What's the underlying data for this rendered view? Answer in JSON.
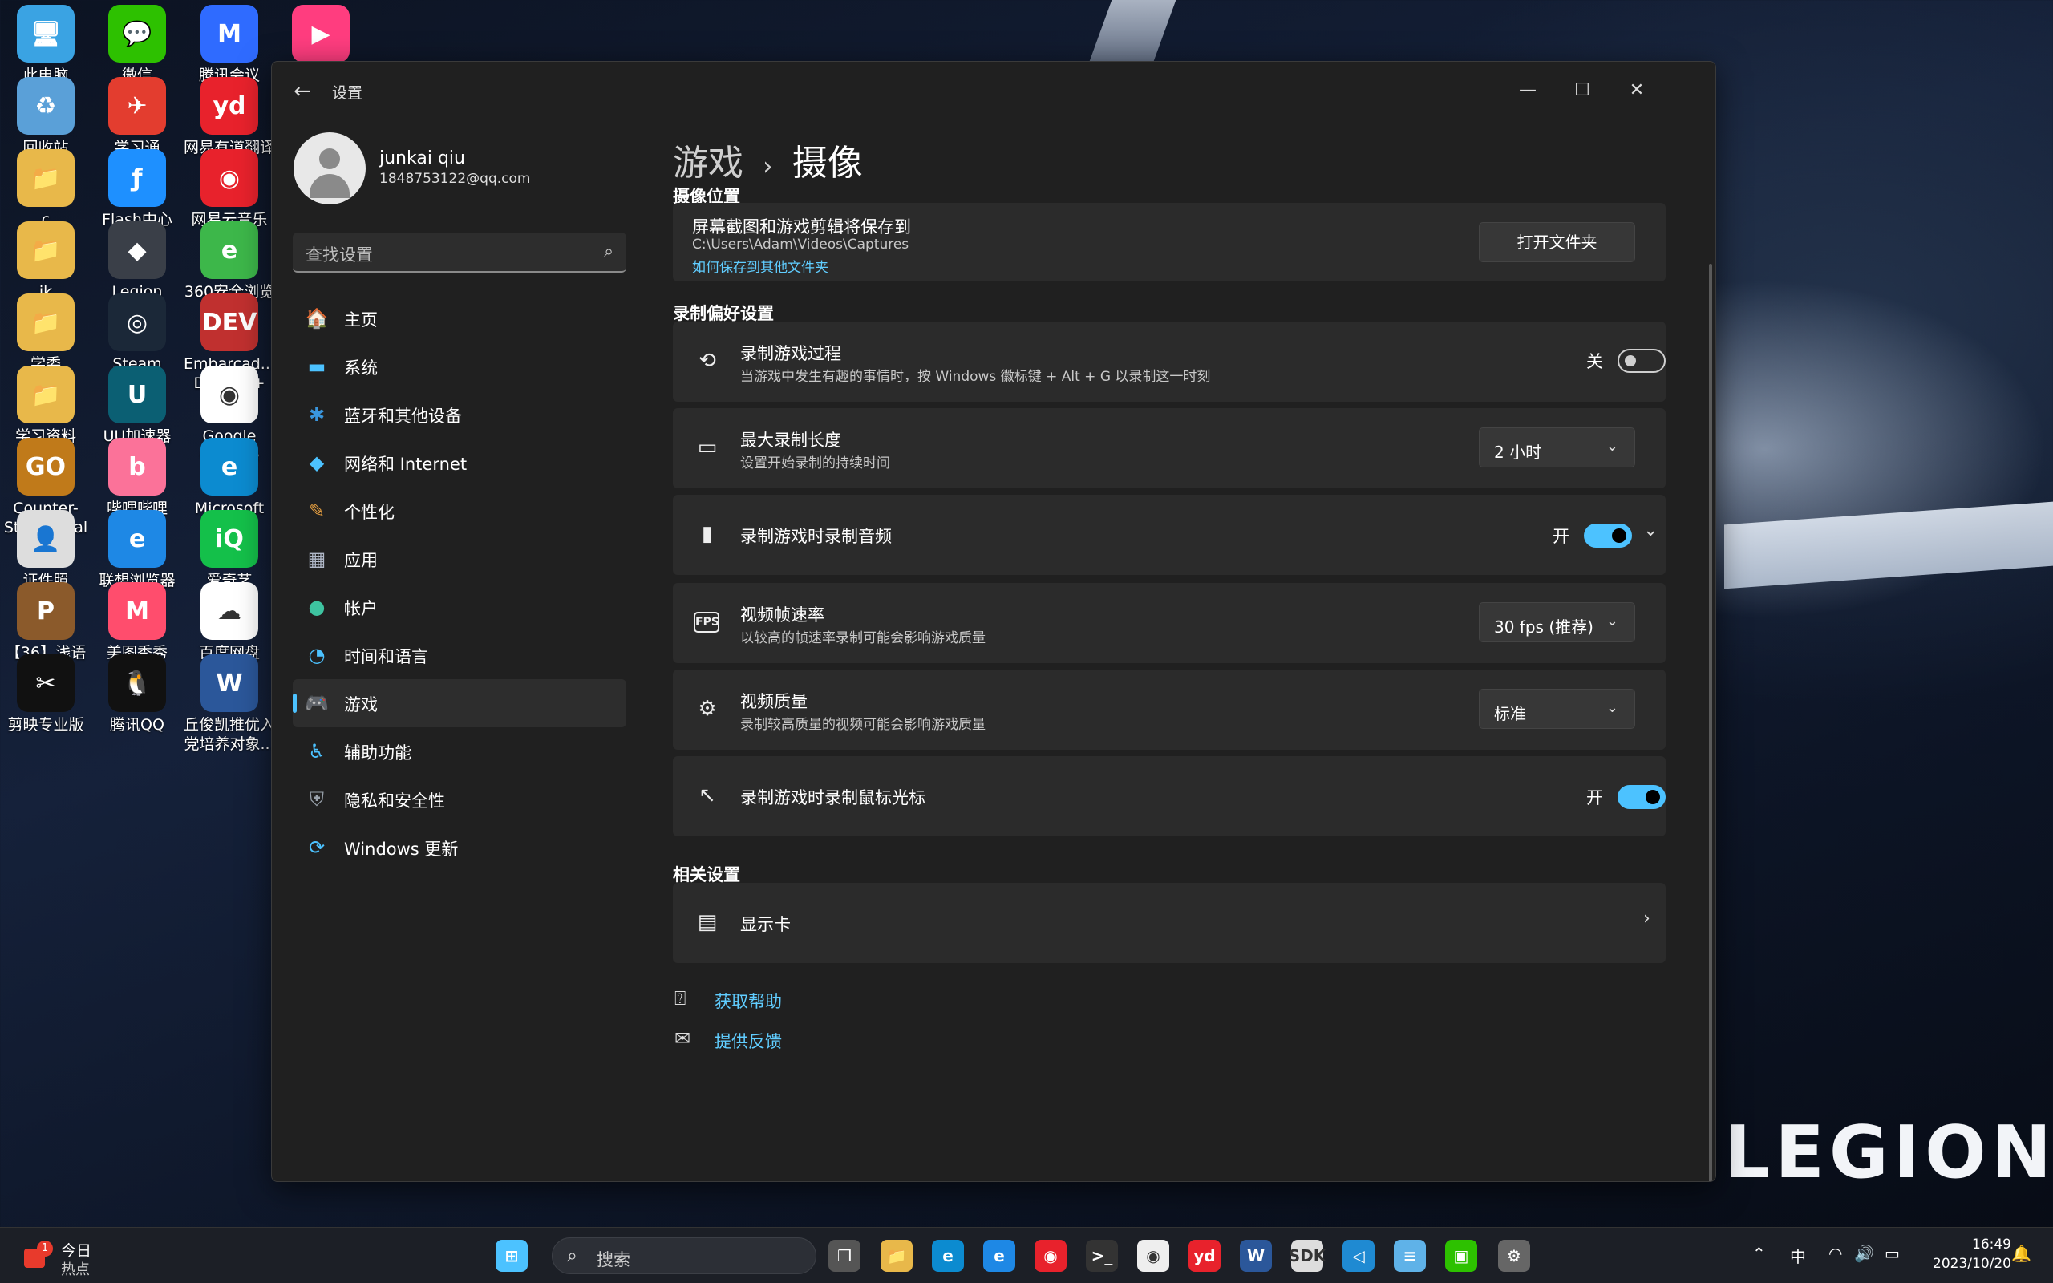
{
  "desktop": {
    "icons": [
      {
        "label": "此电脑",
        "color": "#3aa3e3",
        "glyph": "🖥"
      },
      {
        "label": "微信",
        "color": "#2dc100",
        "glyph": "💬"
      },
      {
        "label": "腾讯会议",
        "color": "#2f6bff",
        "glyph": "M"
      },
      {
        "label": "",
        "color": "#ff3d7f",
        "glyph": "▶"
      },
      {
        "label": "回收站",
        "color": "#5aa0d8",
        "glyph": "♻"
      },
      {
        "label": "学习通",
        "color": "#e33d2f",
        "glyph": "✈"
      },
      {
        "label": "网易有道翻译",
        "color": "#e8222c",
        "glyph": "yd"
      },
      {
        "label": "c",
        "color": "#e8b84a",
        "glyph": "📁"
      },
      {
        "label": "Flash中心",
        "color": "#1e90ff",
        "glyph": "ƒ"
      },
      {
        "label": "网易云音乐",
        "color": "#e8222c",
        "glyph": "◉"
      },
      {
        "label": "jk",
        "color": "#e8b84a",
        "glyph": "📁"
      },
      {
        "label": "Legion Zone",
        "color": "#3a3f48",
        "glyph": "◆"
      },
      {
        "label": "360安全浏览器",
        "color": "#3db74a",
        "glyph": "e"
      },
      {
        "label": "学委",
        "color": "#e8b84a",
        "glyph": "📁"
      },
      {
        "label": "Steam",
        "color": "#1b2838",
        "glyph": "◎"
      },
      {
        "label": "Embarcad... Dev-C++",
        "color": "#c0302f",
        "glyph": "DEV"
      },
      {
        "label": "学习资料",
        "color": "#e8b84a",
        "glyph": "📁"
      },
      {
        "label": "UU加速器",
        "color": "#0b5f73",
        "glyph": "U"
      },
      {
        "label": "Google Chrome",
        "color": "#ffffff",
        "glyph": "◉"
      },
      {
        "label": "Counter-St... Global Off...",
        "color": "#c07a1a",
        "glyph": "GO"
      },
      {
        "label": "哔哩哔哩",
        "color": "#fb7299",
        "glyph": "b"
      },
      {
        "label": "Microsoft Edge",
        "color": "#0c8bd0",
        "glyph": "e"
      },
      {
        "label": "证件照",
        "color": "#dddddd",
        "glyph": "👤"
      },
      {
        "label": "联想浏览器",
        "color": "#1e88e5",
        "glyph": "e"
      },
      {
        "label": "爱奇艺",
        "color": "#14c04a",
        "glyph": "iQ"
      },
      {
        "label": "【36】浅语 PPT模板",
        "color": "#8b5a2b",
        "glyph": "P"
      },
      {
        "label": "美图秀秀",
        "color": "#ff4d6d",
        "glyph": "M"
      },
      {
        "label": "百度网盘",
        "color": "#ffffff",
        "glyph": "☁"
      },
      {
        "label": "剪映专业版",
        "color": "#111111",
        "glyph": "✂"
      },
      {
        "label": "腾讯QQ",
        "color": "#111111",
        "glyph": "🐧"
      },
      {
        "label": "丘俊凯推优入党培养对象...",
        "color": "#2b579a",
        "glyph": "W"
      }
    ],
    "brand": "LEGION"
  },
  "window": {
    "title": "设置",
    "back": "←",
    "minimize": "—",
    "maximize": "☐",
    "close": "✕"
  },
  "user": {
    "name": "junkai qiu",
    "email": "1848753122@qq.com"
  },
  "search": {
    "placeholder": "查找设置",
    "icon": "⌕"
  },
  "nav": [
    {
      "label": "主页",
      "icon": "🏠",
      "color": "#e89a3c"
    },
    {
      "label": "系统",
      "icon": "▬",
      "color": "#4cc2ff"
    },
    {
      "label": "蓝牙和其他设备",
      "icon": "✱",
      "color": "#3a96dd"
    },
    {
      "label": "网络和 Internet",
      "icon": "◆",
      "color": "#4cc2ff"
    },
    {
      "label": "个性化",
      "icon": "✎",
      "color": "#e8a040"
    },
    {
      "label": "应用",
      "icon": "▦",
      "color": "#b0b8c8"
    },
    {
      "label": "帐户",
      "icon": "●",
      "color": "#3ec3a0"
    },
    {
      "label": "时间和语言",
      "icon": "◔",
      "color": "#4cc2ff"
    },
    {
      "label": "游戏",
      "icon": "🎮",
      "color": "#c8c8c8"
    },
    {
      "label": "辅助功能",
      "icon": "♿",
      "color": "#4cc2ff"
    },
    {
      "label": "隐私和安全性",
      "icon": "⛨",
      "color": "#9aa3ad"
    },
    {
      "label": "Windows 更新",
      "icon": "⟳",
      "color": "#4cc2ff"
    }
  ],
  "breadcrumb": {
    "parent": "游戏",
    "sep": "›",
    "current": "摄像"
  },
  "capture": {
    "section": "摄像位置",
    "title": "屏幕截图和游戏剪辑将保存到",
    "path": "C:\\Users\\Adam\\Videos\\Captures",
    "link": "如何保存到其他文件夹",
    "button": "打开文件夹"
  },
  "prefs": {
    "section": "录制偏好设置",
    "record_process": {
      "title": "录制游戏过程",
      "desc": "当游戏中发生有趣的事情时，按 Windows 徽标键 + Alt + G 以录制这一时刻",
      "state": "关",
      "icon": "⟲"
    },
    "max_length": {
      "title": "最大录制长度",
      "desc": "设置开始录制的持续时间",
      "value": "2 小时",
      "icon": "▭"
    },
    "audio": {
      "title": "录制游戏时录制音频",
      "state": "开",
      "icon": "▮"
    },
    "fps": {
      "title": "视频帧速率",
      "desc": "以较高的帧速率录制可能会影响游戏质量",
      "value": "30 fps (推荐)",
      "icon": "FPS"
    },
    "quality": {
      "title": "视频质量",
      "desc": "录制较高质量的视频可能会影响游戏质量",
      "value": "标准",
      "icon": "⚙"
    },
    "cursor": {
      "title": "录制游戏时录制鼠标光标",
      "state": "开",
      "icon": "↖"
    }
  },
  "related": {
    "section": "相关设置",
    "gpu": "显示卡",
    "icon": "▤"
  },
  "help": {
    "get_help": "获取帮助",
    "feedback": "提供反馈"
  },
  "taskbar": {
    "news_title": "今日",
    "news_sub": "热点",
    "news_badge": "1",
    "search": "搜索",
    "ime": "中",
    "time": "16:49",
    "date": "2023/10/20",
    "apps": [
      {
        "name": "start",
        "color": "#4cc2ff",
        "glyph": "⊞"
      },
      {
        "name": "task-view",
        "color": "#555",
        "glyph": "❐"
      },
      {
        "name": "file-explorer",
        "color": "#e8b84a",
        "glyph": "📁"
      },
      {
        "name": "edge",
        "color": "#0c8bd0",
        "glyph": "e"
      },
      {
        "name": "lenovo-browser",
        "color": "#1e88e5",
        "glyph": "e"
      },
      {
        "name": "netease-music",
        "color": "#e8222c",
        "glyph": "◉"
      },
      {
        "name": "terminal",
        "color": "#333",
        "glyph": ">_"
      },
      {
        "name": "chrome",
        "color": "#eee",
        "glyph": "◉"
      },
      {
        "name": "youdao",
        "color": "#e8222c",
        "glyph": "yd"
      },
      {
        "name": "word",
        "color": "#2b579a",
        "glyph": "W"
      },
      {
        "name": "sdk",
        "color": "#ddd",
        "glyph": "SDK"
      },
      {
        "name": "vscode",
        "color": "#1f8ad2",
        "glyph": "◁"
      },
      {
        "name": "notepad",
        "color": "#5fb2e8",
        "glyph": "≡"
      },
      {
        "name": "wechat-mini",
        "color": "#2dc100",
        "glyph": "▣"
      },
      {
        "name": "settings",
        "color": "#666",
        "glyph": "⚙"
      }
    ]
  }
}
